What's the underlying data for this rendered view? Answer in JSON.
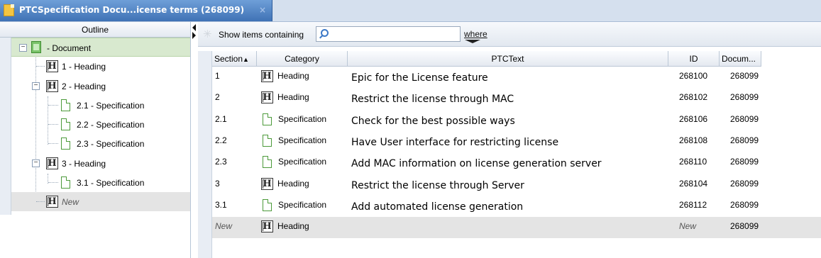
{
  "tab": {
    "title": "PTCSpecification Docu...icense terms (268099)",
    "close": "×"
  },
  "outline": {
    "header": "Outline",
    "items": [
      {
        "label": "- Document",
        "type": "document"
      },
      {
        "label": "1 - Heading",
        "type": "heading"
      },
      {
        "label": "2 - Heading",
        "type": "heading"
      },
      {
        "label": "2.1 - Specification",
        "type": "specification"
      },
      {
        "label": "2.2 - Specification",
        "type": "specification"
      },
      {
        "label": "2.3 - Specification",
        "type": "specification"
      },
      {
        "label": "3 - Heading",
        "type": "heading"
      },
      {
        "label": "3.1 - Specification",
        "type": "specification"
      },
      {
        "label": "New",
        "type": "heading"
      }
    ]
  },
  "toolbar": {
    "show_label": "Show items containing",
    "search_value": "",
    "where_label": "where"
  },
  "grid": {
    "columns": {
      "section": "Section",
      "category": "Category",
      "text": "PTCText",
      "id": "ID",
      "document": "Docum..."
    },
    "sort_indicator": "▲",
    "rows": [
      {
        "section": "1",
        "category": "Heading",
        "text": "Epic for the License feature",
        "id": "268100",
        "document": "268099"
      },
      {
        "section": "2",
        "category": "Heading",
        "text": "Restrict the license through MAC",
        "id": "268102",
        "document": "268099"
      },
      {
        "section": "2.1",
        "category": "Specification",
        "text": "Check for the best possible ways",
        "id": "268106",
        "document": "268099"
      },
      {
        "section": "2.2",
        "category": "Specification",
        "text": "Have User interface for restricting license",
        "id": "268108",
        "document": "268099"
      },
      {
        "section": "2.3",
        "category": "Specification",
        "text": "Add MAC information on license generation server",
        "id": "268110",
        "document": "268099"
      },
      {
        "section": "3",
        "category": "Heading",
        "text": "Restrict the license through Server",
        "id": "268104",
        "document": "268099"
      },
      {
        "section": "3.1",
        "category": "Specification",
        "text": "Add automated license generation",
        "id": "268112",
        "document": "268099"
      },
      {
        "section": "New",
        "category": "Heading",
        "text": "",
        "id": "New",
        "document": "268099"
      }
    ]
  },
  "icons": {
    "document": "document-icon",
    "heading": "heading-icon",
    "specification": "specification-icon",
    "search": "search-icon",
    "filter": "filter-star-icon"
  },
  "colors": {
    "tab_active": "#4a7cc0",
    "selected_row": "#d8e9cf",
    "new_row": "#e4e4e4",
    "spec_icon": "#4c9a3a"
  }
}
